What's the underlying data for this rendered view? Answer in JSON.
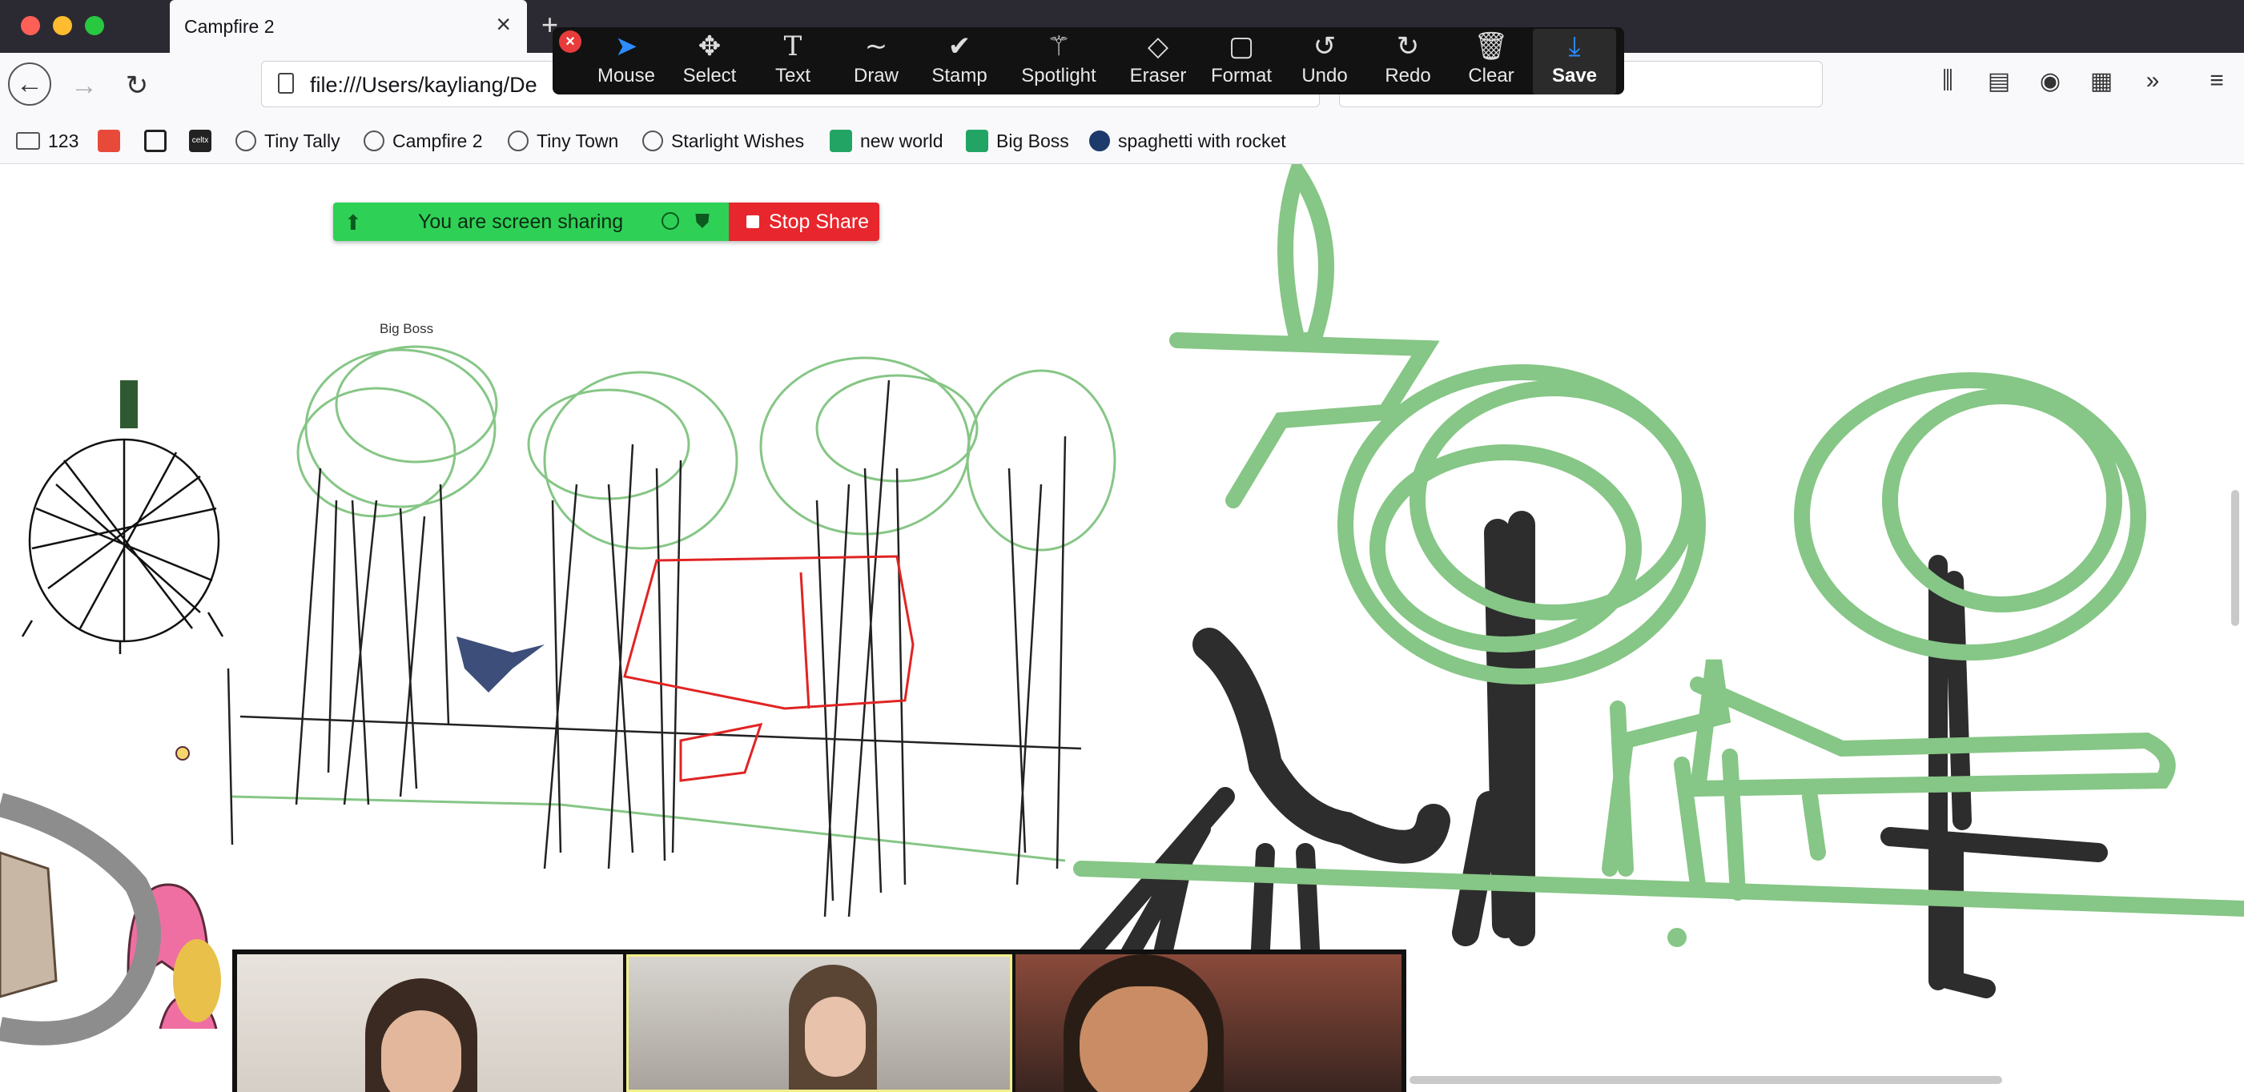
{
  "browser": {
    "tab_title": "Campfire 2",
    "url": "file:///Users/kayliang/De",
    "bookmarks": [
      {
        "label": "123",
        "icon": "folder-icon"
      },
      {
        "label": "",
        "icon": "game-icon-1"
      },
      {
        "label": "",
        "icon": "game-icon-2"
      },
      {
        "label": "celtx",
        "icon": "celtx-icon"
      },
      {
        "label": "Tiny Tally",
        "icon": "globe-icon"
      },
      {
        "label": "Campfire 2",
        "icon": "globe-icon"
      },
      {
        "label": "Tiny Town",
        "icon": "globe-icon"
      },
      {
        "label": "Starlight Wishes",
        "icon": "globe-icon"
      },
      {
        "label": "new world",
        "icon": "sheets-icon"
      },
      {
        "label": "Big Boss",
        "icon": "sheets-icon"
      },
      {
        "label": "spaghetti with rocket",
        "icon": "globe-icon"
      }
    ]
  },
  "annotation_toolbar": {
    "tools": [
      {
        "label": "Mouse",
        "icon": "cursor-icon"
      },
      {
        "label": "Select",
        "icon": "move-icon"
      },
      {
        "label": "Text",
        "icon": "text-icon"
      },
      {
        "label": "Draw",
        "icon": "squiggle-icon"
      },
      {
        "label": "Stamp",
        "icon": "check-icon"
      },
      {
        "label": "Spotlight",
        "icon": "wand-icon"
      },
      {
        "label": "Eraser",
        "icon": "eraser-icon"
      },
      {
        "label": "Format",
        "icon": "square-icon"
      },
      {
        "label": "Undo",
        "icon": "undo-icon"
      },
      {
        "label": "Redo",
        "icon": "redo-icon"
      },
      {
        "label": "Clear",
        "icon": "trash-icon"
      },
      {
        "label": "Save",
        "icon": "download-icon"
      }
    ],
    "active_tool": "Mouse",
    "accent_color": "#2d8cff"
  },
  "share_bar": {
    "status_text": "You are screen sharing",
    "stop_label": "Stop Share",
    "status_color": "#2ed156",
    "stop_color": "#e8262d"
  },
  "canvas": {
    "embedded_tag": "Big Boss"
  }
}
